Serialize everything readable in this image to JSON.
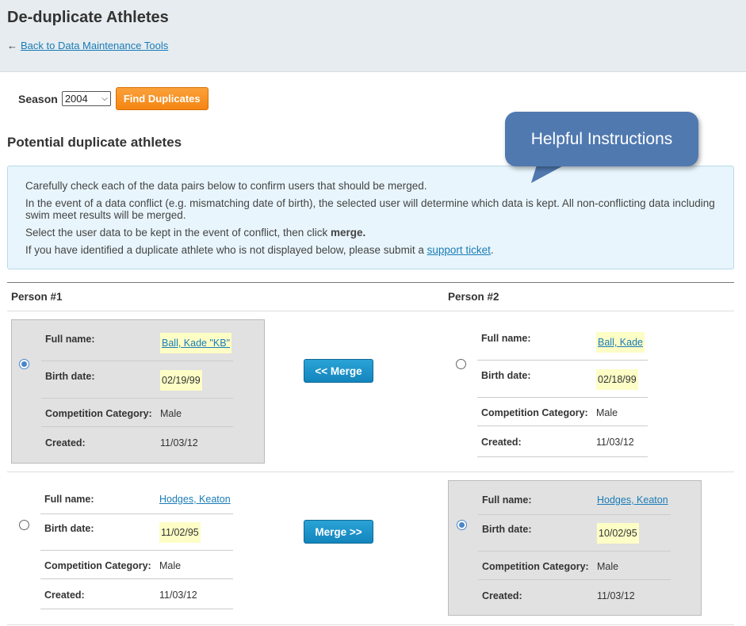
{
  "page": {
    "title": "De-duplicate Athletes",
    "back_arrow": "←",
    "back_link": "Back to Data Maintenance Tools"
  },
  "season": {
    "label": "Season",
    "selected": "2004",
    "chevron_icon": "chevron-down-icon"
  },
  "find_button": "Find Duplicates",
  "section_title": "Potential duplicate athletes",
  "callout": "Helpful Instructions",
  "instructions": {
    "line1": "Carefully check each of the data pairs below to confirm users that should be merged.",
    "line2": "In the event of a data conflict (e.g. mismatching date of birth), the selected user will determine which data is kept. All non-conflicting data including swim meet results will be merged.",
    "line3_prefix": "Select the user data to be kept in the event of conflict, then click ",
    "line3_bold": "merge.",
    "line4_prefix": "If you have identified a duplicate athlete who is not displayed below, please submit a ",
    "line4_link": "support ticket",
    "line4_suffix": "."
  },
  "table": {
    "col1": "Person #1",
    "col2": "Person #2"
  },
  "labels": {
    "full_name": "Full name:",
    "birth_date": "Birth date:",
    "competition_category": "Competition Category:",
    "created": "Created:"
  },
  "pairs": [
    {
      "merge_label": "<< Merge",
      "selected": "left",
      "left": {
        "name": "Ball, Kade \"KB\"",
        "birth": "02/19/99",
        "category": "Male",
        "created": "11/03/12"
      },
      "right": {
        "name": "Ball, Kade",
        "birth": "02/18/99",
        "category": "Male",
        "created": "11/03/12"
      }
    },
    {
      "merge_label": "Merge >>",
      "selected": "right",
      "left": {
        "name": "Hodges, Keaton",
        "birth": "11/02/95",
        "category": "Male",
        "created": "11/03/12"
      },
      "right": {
        "name": "Hodges, Keaton",
        "birth": "10/02/95",
        "category": "Male",
        "created": "11/03/12"
      }
    }
  ],
  "colors": {
    "header_bg": "#e6ecef",
    "find_button": "#f48512",
    "merge_button": "#1385bd",
    "callout": "#5079b0",
    "info_bg": "#e8f5fc",
    "highlight": "#fdfdc6",
    "link": "#1a7cb8"
  }
}
